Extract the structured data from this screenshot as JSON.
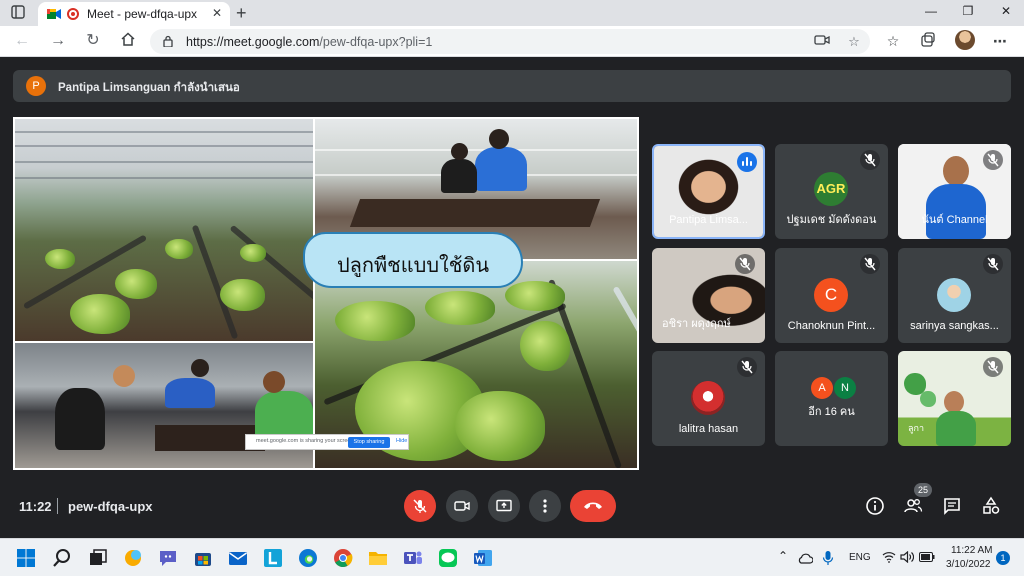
{
  "browser": {
    "tab_title": "Meet - pew-dfqa-upx",
    "url_host": "https://meet.google.com",
    "url_path": "/pew-dfqa-upx?pli=1",
    "icons": [
      "tab-actions-icon",
      "meet-favicon",
      "recording-icon",
      "close-tab-icon",
      "new-tab-icon",
      "back-icon",
      "forward-icon",
      "reload-icon",
      "home-icon",
      "lock-icon",
      "camera-icon",
      "add-favorite-icon",
      "favorites-icon",
      "collections-icon",
      "more-icon"
    ]
  },
  "meet": {
    "presenter_banner": {
      "avatar_letter": "P",
      "text": "Pantipa Limsanguan กำลังนำเสนอ"
    },
    "shared_screen": {
      "slide_caption": "ปลูกพืชแบบใช้ดิน",
      "share_bar_text": "meet.google.com is sharing your screen.",
      "stop_sharing_label": "Stop sharing",
      "hide_label": "Hide"
    },
    "participants": [
      {
        "name": "Pantipa Limsa...",
        "type": "video",
        "speaking": true
      },
      {
        "name": "ปฐมเดช มัดดังดอน",
        "type": "logo",
        "logo_text": "AGR",
        "muted": true
      },
      {
        "name": "นันต์ Channel",
        "type": "video",
        "muted": true
      },
      {
        "name": "อชิรา ผดุงฤกษ์",
        "type": "video",
        "muted": true
      },
      {
        "name": "Chanoknun Pint...",
        "type": "letter",
        "letter": "C",
        "color": "#f4511e",
        "muted": true
      },
      {
        "name": "sarinya sangkas...",
        "type": "photo",
        "muted": true
      },
      {
        "name": "lalitra hasan",
        "type": "photo",
        "muted": true
      },
      {
        "name": "อีก 16 คน",
        "type": "group",
        "letters": [
          "A",
          "N"
        ],
        "colors": [
          "#f4511e",
          "#0b8043"
        ]
      },
      {
        "name": "ลูกา",
        "type": "video",
        "muted": true
      }
    ],
    "bottom_bar": {
      "time": "11:22",
      "meeting_code": "pew-dfqa-upx",
      "participants_count": "25",
      "controls": [
        "mic-off-icon",
        "camera-icon",
        "present-icon",
        "more-options-icon",
        "end-call-icon"
      ],
      "right_controls": [
        "info-icon",
        "people-icon",
        "chat-icon",
        "activities-icon"
      ]
    }
  },
  "taskbar": {
    "language": "ENG",
    "time": "11:22 AM",
    "date": "3/10/2022",
    "notifications": "1",
    "apps": [
      "start-icon",
      "search-icon",
      "task-view-icon",
      "widgets-icon",
      "teams-chat-icon",
      "store-icon",
      "mail-icon",
      "launcher-l-icon",
      "edge-icon",
      "chrome-icon",
      "file-explorer-icon",
      "teams-icon",
      "line-icon",
      "word-icon"
    ]
  }
}
